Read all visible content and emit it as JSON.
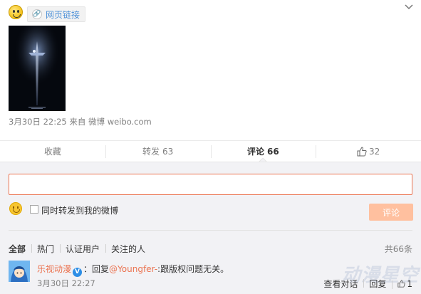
{
  "post": {
    "link_label": "网页链接",
    "meta_time": "3月30日 22:25",
    "meta_from": "来自",
    "meta_source": "微博 weibo.com"
  },
  "actions": {
    "favorite_label": "收藏",
    "repost_label": "转发",
    "repost_count": "63",
    "comment_label": "评论",
    "comment_count": "66",
    "like_count": "32"
  },
  "compose": {
    "input_value": "",
    "repost_option_label": "同时转发到我的微博",
    "submit_label": "评论"
  },
  "filters": {
    "items": [
      "全部",
      "热门",
      "认证用户",
      "关注的人"
    ],
    "total": "共66条"
  },
  "comment": {
    "user": "乐视动漫",
    "colon": "：回复",
    "mention": "@Youngfer-",
    "text": ":跟版权问题无关。",
    "time": "3月30日 22:27",
    "ops": [
      "查看对话",
      "回复"
    ],
    "like_count": "1"
  },
  "watermark": "动漫星空",
  "colors": {
    "accent": "#eb7350",
    "link": "#4a8fd8",
    "submit_disabled": "#ffc09f",
    "panel_bg": "#f2f2f5"
  },
  "icons": {
    "emoji": "crying-face-emoji",
    "link": "link-icon",
    "chevron": "chevron-down-icon",
    "like": "thumbs-up-icon",
    "smiley": "smiley-icon",
    "verified": "verified-badge-icon"
  }
}
